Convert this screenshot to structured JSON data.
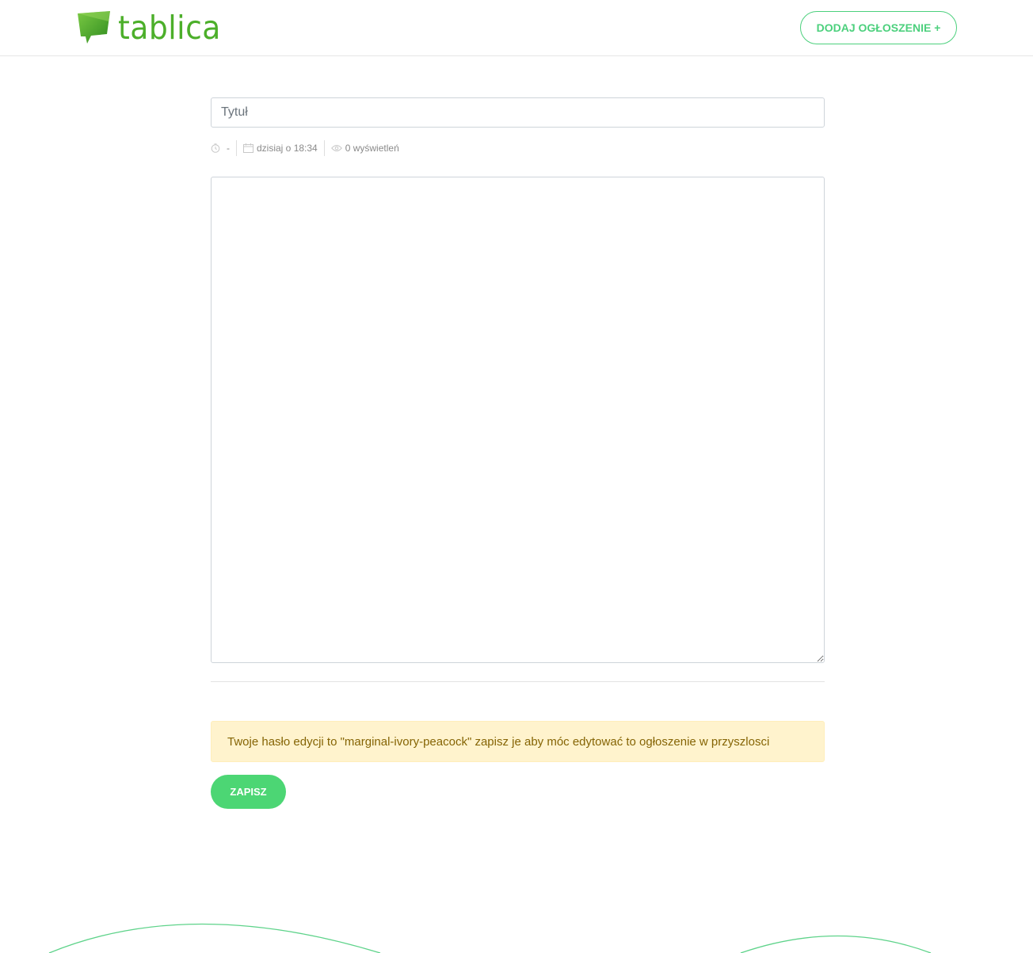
{
  "header": {
    "logo_text": "tablica",
    "add_button_label": "DODAJ OGŁOSZENIE +"
  },
  "form": {
    "title_placeholder": "Tytuł",
    "title_value": "",
    "content_value": "",
    "save_label": "ZAPISZ"
  },
  "meta": {
    "expiry": "-",
    "date": "dzisiaj o 18:34",
    "views": "0 wyświetleń",
    "icons": [
      "clock-icon",
      "calendar-icon",
      "eye-icon"
    ]
  },
  "alert": {
    "message": "Twoje hasło edycji to \"marginal-ivory-peacock\" zapisz je aby móc edytować to ogłoszenie w przyszlosci"
  },
  "colors": {
    "accent": "#4cd07d",
    "logo_green": "#4caf2a",
    "save_button": "#4cd674",
    "alert_bg": "#fff3cd",
    "alert_text": "#856404"
  }
}
